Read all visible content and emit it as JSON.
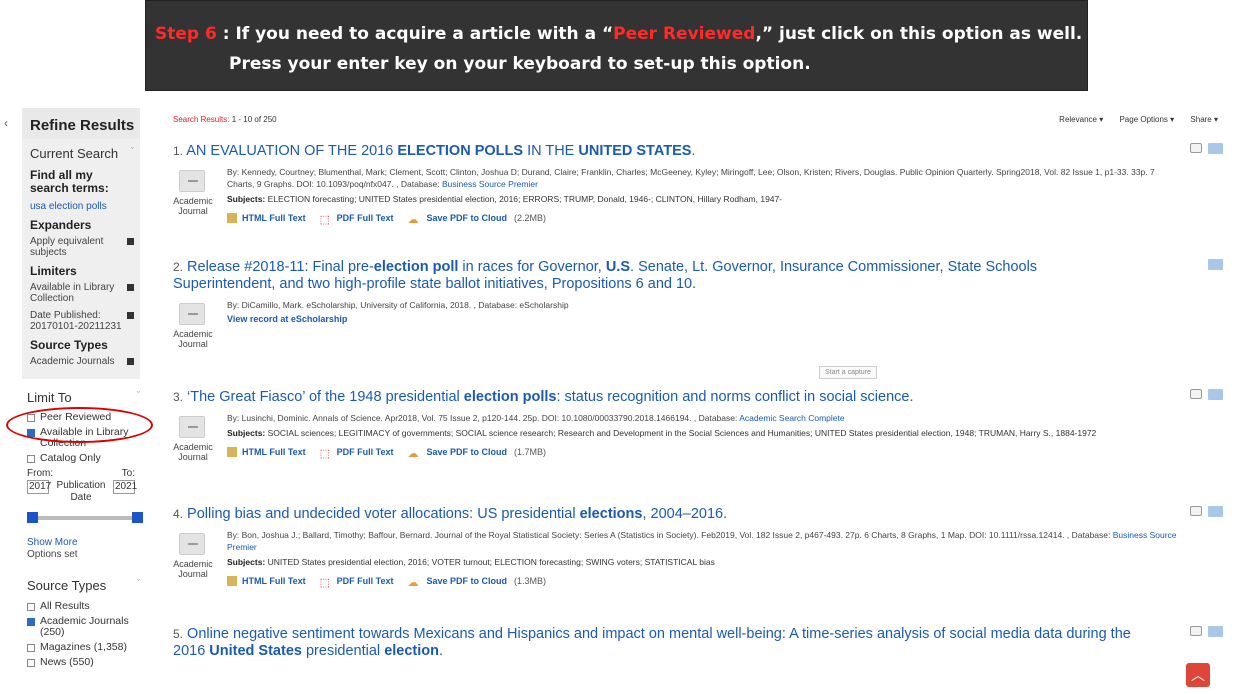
{
  "banner": {
    "step": "Step 6",
    "line1_a": " : If you need to acquire a article with a “",
    "peer": "Peer Reviewed",
    "line1_b": ",” just click on this option as well.",
    "line2": "Press your enter key on your keyboard to set-up this option."
  },
  "sidebar": {
    "handle": "‹",
    "title": "Refine Results",
    "current_search": "Current Search",
    "find_all": "Find all my search terms:",
    "term": "usa election polls",
    "expanders": "Expanders",
    "expander_item": "Apply equivalent subjects",
    "limiters": "Limiters",
    "limiter_1": "Available in Library Collection",
    "limiter_2": "Date Published: 20170101-20211231",
    "source_types": "Source Types",
    "source_item": "Academic Journals",
    "limit_to": "Limit To",
    "cb_peer": "Peer Reviewed",
    "cb_available": "Available in Library Collection",
    "cb_catalog": "Catalog Only",
    "from_label": "From:",
    "to_label": "To:",
    "from_val": "2017",
    "to_val": "2021",
    "pub_date": "Publication Date",
    "show_more": "Show More",
    "options_set": "Options set",
    "source_types_2": "Source Types",
    "st_all": "All Results",
    "st_academic": "Academic Journals (250)",
    "st_magazines": "Magazines (1,358)",
    "st_news": "News (550)"
  },
  "main": {
    "search_results_label": "Search Results:",
    "search_results_count": " 1 - 10 of 250",
    "relevance": "Relevance ▾",
    "page_options": "Page Options ▾",
    "share": "Share ▾",
    "capture": "Start a capture",
    "scroll_top": "︿"
  },
  "results": [
    {
      "num": "1.",
      "t1": " AN EVALUATION OF THE 2016 ",
      "t2": "ELECTION POLLS",
      "t3": " IN THE ",
      "t4": "UNITED STATES",
      "t5": ".",
      "meta": "By: Kennedy, Courtney; Blumenthal, Mark; Clement, Scott; Clinton, Joshua D; Durand, Claire; Franklin, Charles; McGeeney, Kyley; Miringoff, Lee; Olson, Kristen; Rivers, Douglas. Public Opinion Quarterly. Spring2018, Vol. 82 Issue 1, p1-33. 33p. 7 Charts, 9 Graphs. DOI: 10.1093/poq/nfx047. , Database: ",
      "db": "Business Source Premier",
      "subjects_label": "Subjects: ",
      "subjects": "ELECTION forecasting; UNITED States presidential election, 2016; ERRORS; TRUMP, Donald, 1946-; CLINTON, Hillary Rodham, 1947-",
      "html": "HTML Full Text",
      "pdf": "PDF Full Text",
      "cloud": "Save PDF to Cloud",
      "size": "(2.2MB)",
      "type": "Academic Journal"
    },
    {
      "num": "2.",
      "t1": " Release #2018-11: Final pre-",
      "t2": "election poll",
      "t3": " in races for Governor, ",
      "t4": "U.S",
      "t5": ". Senate, Lt. Governor, Insurance Commissioner, State Schools Superintendent, and two high-profile state ballot initiatives, Propositions 6 and 10.",
      "meta": "By: DiCamillo, Mark. eScholarship, University of California, 2018. , Database: eScholarship",
      "view": "View record at eScholarship",
      "type": "Academic Journal"
    },
    {
      "num": "3.",
      "t1": " ‘The Great Fiasco’ of the 1948 presidential ",
      "t2": "election polls",
      "t3": ": status recognition and norms conflict in social science.",
      "meta": "By: Lusinchi, Dominic. Annals of Science. Apr2018, Vol. 75 Issue 2, p120-144. 25p. DOI: 10.1080/00033790.2018.1466194. , Database: ",
      "db": "Academic Search Complete",
      "subjects_label": "Subjects: ",
      "subjects": "SOCIAL sciences; LEGITIMACY of governments; SOCIAL science research; Research and Development in the Social Sciences and Humanities; UNITED States presidential election, 1948; TRUMAN, Harry S., 1884-1972",
      "html": "HTML Full Text",
      "pdf": "PDF Full Text",
      "cloud": "Save PDF to Cloud",
      "size": "(1.7MB)",
      "type": "Academic Journal"
    },
    {
      "num": "4.",
      "t1": " Polling bias and undecided voter allocations: US presidential ",
      "t2": "elections",
      "t3": ", 2004–2016.",
      "meta": "By: Bon, Joshua J.; Ballard, Timothy; Baffour, Bernard. Journal of the Royal Statistical Society: Series A (Statistics in Society). Feb2019, Vol. 182 Issue 2, p467-493. 27p. 6 Charts, 8 Graphs, 1 Map. DOI: 10.1111/rssa.12414. , Database: ",
      "db": "Business Source Premier",
      "subjects_label": "Subjects: ",
      "subjects": "UNITED States presidential election, 2016; VOTER turnout; ELECTION forecasting; SWING voters; STATISTICAL bias",
      "html": "HTML Full Text",
      "pdf": "PDF Full Text",
      "cloud": "Save PDF to Cloud",
      "size": "(1.3MB)",
      "type": "Academic Journal"
    },
    {
      "num": "5.",
      "t1": " Online negative sentiment towards Mexicans and Hispanics and impact on mental well-being: A time-series analysis of social media data during the 2016 ",
      "t2": "United States",
      "t3": " presidential ",
      "t4": "election",
      "t5": "."
    }
  ]
}
